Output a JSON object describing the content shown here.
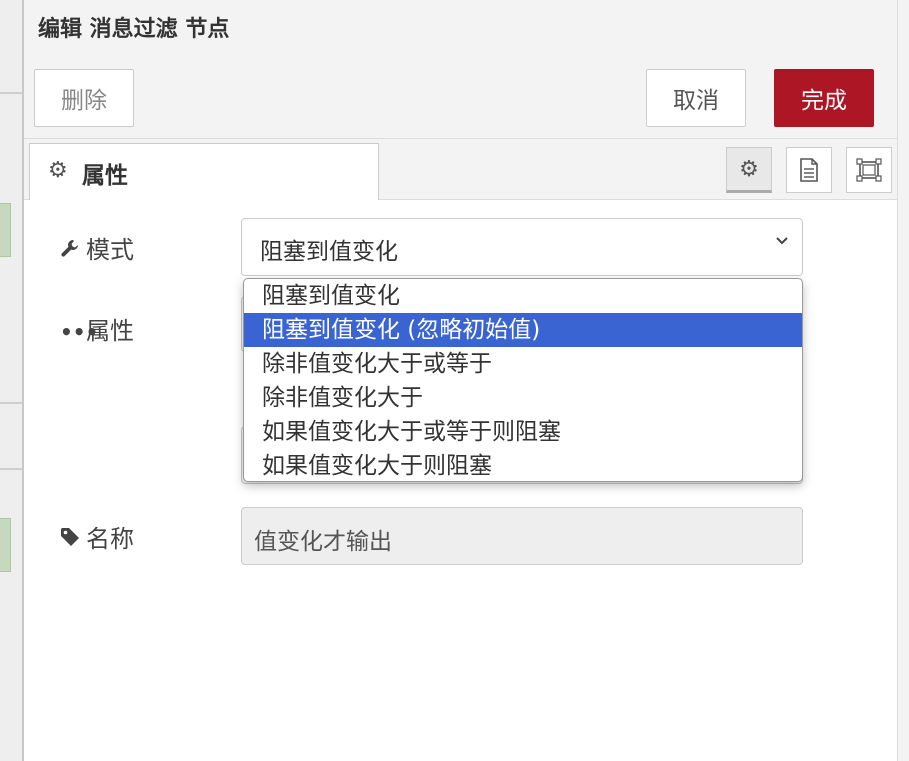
{
  "tray": {
    "title": "编辑 消息过滤 节点"
  },
  "toolbar": {
    "delete_label": "删除",
    "cancel_label": "取消",
    "done_label": "完成"
  },
  "tabs": {
    "properties_label": "属性",
    "active_tool": "gear-icon"
  },
  "form": {
    "mode_label": "模式",
    "mode_value": "阻塞到值变化",
    "property_label": "属性",
    "name_label": "名称",
    "name_value": "值变化才输出"
  },
  "dropdown": {
    "options": [
      "阻塞到值变化",
      "阻塞到值变化 (忽略初始值)",
      "除非值变化大于或等于",
      "除非值变化大于",
      "如果值变化大于或等于则阻塞",
      "如果值变化大于则阻塞"
    ],
    "highlighted_index": 1
  },
  "colors": {
    "done_button": "#ad1625",
    "highlight": "#3964d2"
  }
}
